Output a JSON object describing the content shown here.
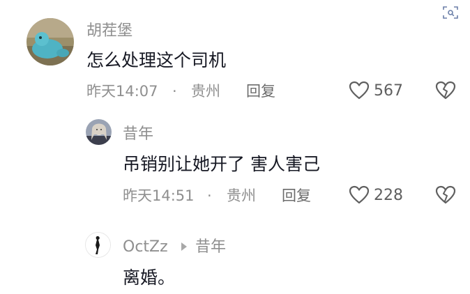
{
  "corner_icon": "scan-icon",
  "comments": [
    {
      "author": "胡茬堡",
      "text": "怎么处理这个司机",
      "time": "昨天14:07",
      "location": "贵州",
      "reply_label": "回复",
      "likes": "567"
    },
    {
      "author": "昔年",
      "text": "吊销别让她开了 害人害己",
      "time": "昨天14:51",
      "location": "贵州",
      "reply_label": "回复",
      "likes": "228"
    },
    {
      "author": "OctZz",
      "reply_to": "昔年",
      "text": "离婚。"
    }
  ],
  "separator": "·",
  "colors": {
    "meta": "#8f8f8f",
    "text": "#161823",
    "icon": "#6b6b6b"
  }
}
